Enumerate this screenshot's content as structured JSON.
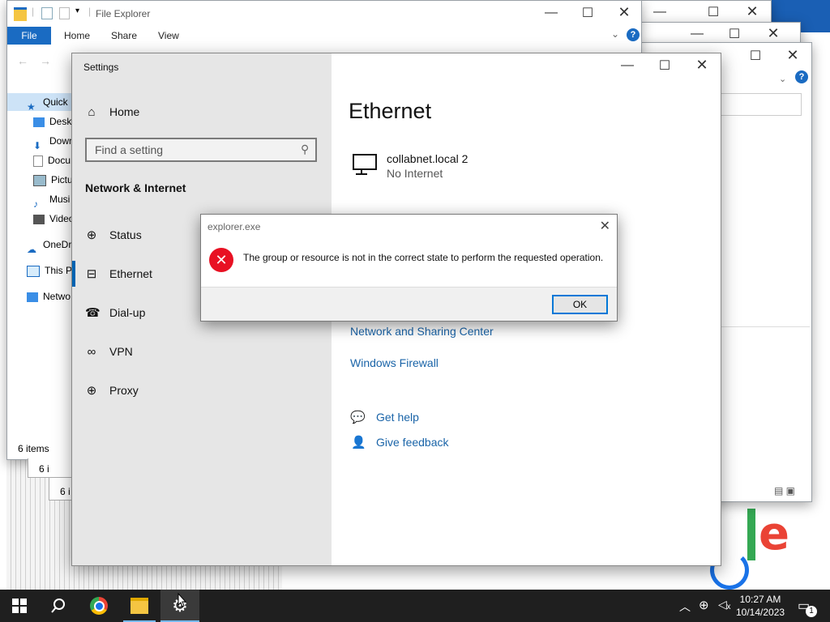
{
  "file_explorer": {
    "title": "File Explorer",
    "tabs": [
      "File",
      "Home",
      "Share",
      "View"
    ],
    "nav": [
      "Quick",
      "Deskt",
      "Down",
      "Docu",
      "Pictu",
      "Musi",
      "Video",
      "OneDr",
      "This PC",
      "Netwo"
    ],
    "status": "6 items",
    "status_back1": "6 i",
    "status_back2": "6 i"
  },
  "settings": {
    "title": "Settings",
    "home": "Home",
    "search_placeholder": "Find a setting",
    "section": "Network & Internet",
    "nav": [
      {
        "icon": "globe-icon",
        "label": "Status"
      },
      {
        "icon": "ethernet-icon",
        "label": "Ethernet"
      },
      {
        "icon": "dialup-icon",
        "label": "Dial-up"
      },
      {
        "icon": "vpn-icon",
        "label": "VPN"
      },
      {
        "icon": "globe-icon",
        "label": "Proxy"
      }
    ],
    "page_title": "Ethernet",
    "network_name": "collabnet.local 2",
    "network_status": "No Internet",
    "links": [
      "Network and Sharing Center",
      "Windows Firewall"
    ],
    "help": [
      "Get help",
      "Give feedback"
    ]
  },
  "dialog": {
    "title": "explorer.exe",
    "message": "The group or resource is not in the correct state to perform the requested operation.",
    "ok": "OK"
  },
  "taskbar": {
    "time": "10:27 AM",
    "date": "10/14/2023",
    "notif_count": "1"
  }
}
